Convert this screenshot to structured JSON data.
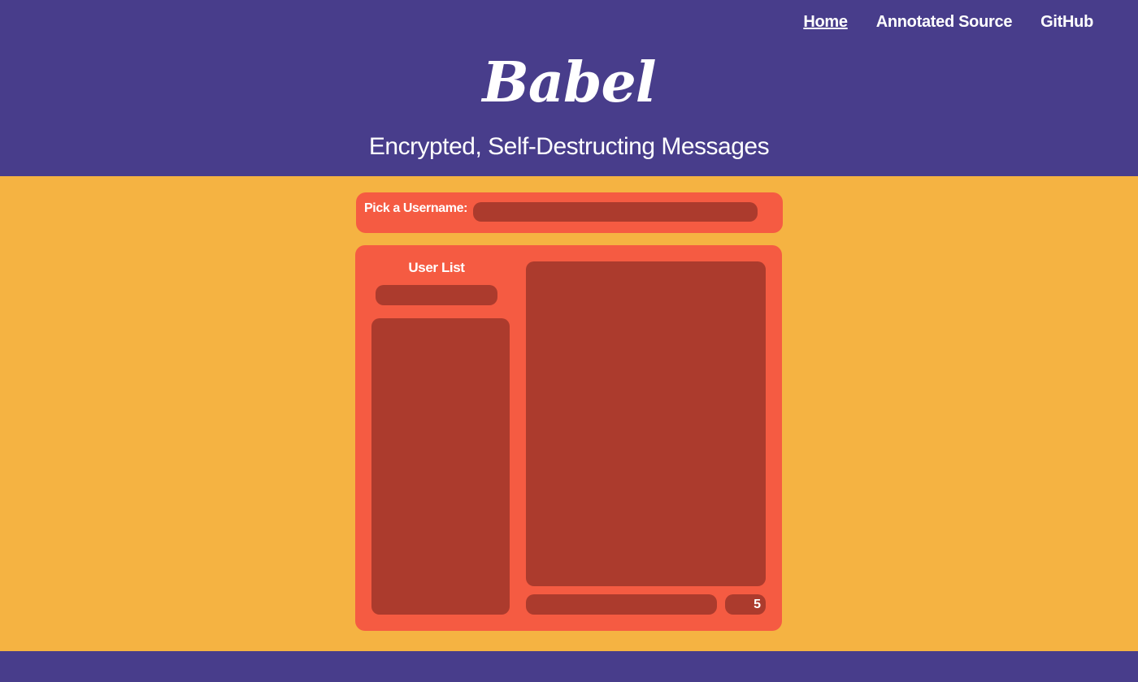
{
  "nav": {
    "items": [
      "Home",
      "Annotated Source",
      "GitHub"
    ]
  },
  "header": {
    "logo": "Babel",
    "tagline": "Encrypted, Self-Destructing Messages"
  },
  "username": {
    "label": "Pick a Username:",
    "value": ""
  },
  "chat": {
    "user_list_title": "User List",
    "user_search_value": "",
    "message_value": "",
    "timer_value": "5"
  },
  "colors": {
    "header_bg": "#483D8B",
    "main_bg": "#F5B342",
    "panel_bg": "#F55B42",
    "field_bg": "#AC3B2D",
    "text": "#FFFFFF"
  }
}
